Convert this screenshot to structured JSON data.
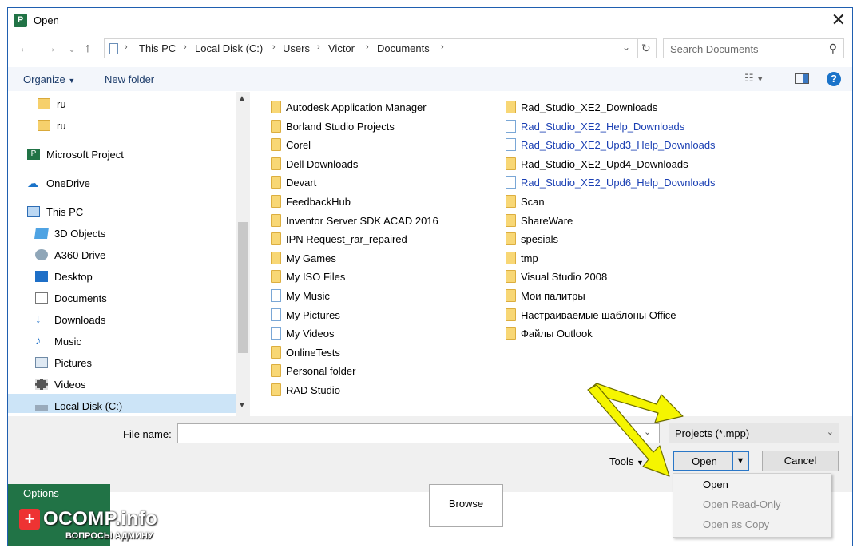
{
  "window": {
    "title": "Open",
    "close": "✕"
  },
  "nav": {
    "back": "←",
    "forward": "→",
    "up": "↑",
    "recent": "⌄"
  },
  "breadcrumb": [
    "This PC",
    "Local Disk (C:)",
    "Users",
    "Victor",
    "Documents"
  ],
  "search": {
    "placeholder": "Search Documents"
  },
  "toolbar": {
    "organize": "Organize",
    "new_folder": "New folder",
    "help": "?"
  },
  "sidebar": {
    "items": [
      {
        "label": "ru",
        "icon": "folder-icon"
      },
      {
        "label": "ru",
        "icon": "folder-icon"
      },
      {
        "label": "Microsoft Project",
        "icon": "microsoft-project-icon"
      },
      {
        "label": "OneDrive",
        "icon": "cloud-icon"
      },
      {
        "label": "This PC",
        "icon": "computer-icon"
      },
      {
        "label": "3D Objects",
        "icon": "cube-icon"
      },
      {
        "label": "A360 Drive",
        "icon": "drive-icon"
      },
      {
        "label": "Desktop",
        "icon": "desktop-icon"
      },
      {
        "label": "Documents",
        "icon": "documents-icon"
      },
      {
        "label": "Downloads",
        "icon": "download-arrow-icon"
      },
      {
        "label": "Music",
        "icon": "music-note-icon"
      },
      {
        "label": "Pictures",
        "icon": "pictures-icon"
      },
      {
        "label": "Videos",
        "icon": "film-icon"
      },
      {
        "label": "Local Disk (C:)",
        "icon": "disk-icon"
      }
    ]
  },
  "files": {
    "col1": [
      {
        "name": "Autodesk Application Manager",
        "kind": "folder"
      },
      {
        "name": "Borland Studio Projects",
        "kind": "folder"
      },
      {
        "name": "Corel",
        "kind": "folder"
      },
      {
        "name": "Dell Downloads",
        "kind": "folder"
      },
      {
        "name": "Devart",
        "kind": "folder"
      },
      {
        "name": "FeedbackHub",
        "kind": "folder"
      },
      {
        "name": "Inventor Server SDK ACAD 2016",
        "kind": "folder"
      },
      {
        "name": "IPN Request_rar_repaired",
        "kind": "folder"
      },
      {
        "name": "My Games",
        "kind": "folder"
      },
      {
        "name": "My ISO Files",
        "kind": "folder"
      },
      {
        "name": "My Music",
        "kind": "shortcut"
      },
      {
        "name": "My Pictures",
        "kind": "shortcut"
      },
      {
        "name": "My Videos",
        "kind": "shortcut"
      },
      {
        "name": "OnlineTests",
        "kind": "folder"
      },
      {
        "name": "Personal folder",
        "kind": "folder"
      },
      {
        "name": "RAD Studio",
        "kind": "folder"
      }
    ],
    "col2": [
      {
        "name": "Rad_Studio_XE2_Downloads",
        "kind": "folder"
      },
      {
        "name": "Rad_Studio_XE2_Help_Downloads",
        "kind": "link"
      },
      {
        "name": "Rad_Studio_XE2_Upd3_Help_Downloads",
        "kind": "link"
      },
      {
        "name": "Rad_Studio_XE2_Upd4_Downloads",
        "kind": "folder"
      },
      {
        "name": "Rad_Studio_XE2_Upd6_Help_Downloads",
        "kind": "link"
      },
      {
        "name": "Scan",
        "kind": "folder"
      },
      {
        "name": "ShareWare",
        "kind": "folder"
      },
      {
        "name": "spesials",
        "kind": "folder"
      },
      {
        "name": "tmp",
        "kind": "folder"
      },
      {
        "name": "Visual Studio 2008",
        "kind": "folder"
      },
      {
        "name": "Мои палитры",
        "kind": "folder"
      },
      {
        "name": "Настраиваемые шаблоны Office",
        "kind": "folder"
      },
      {
        "name": "Файлы Outlook",
        "kind": "folder"
      }
    ]
  },
  "footer": {
    "file_name_label": "File name:",
    "file_name_value": "",
    "file_type": "Projects (*.mpp)",
    "tools": "Tools",
    "open": "Open",
    "cancel": "Cancel"
  },
  "open_menu": [
    "Open",
    "Open Read-Only",
    "Open as Copy"
  ],
  "backstage": {
    "options": "Options",
    "browse": "Browse"
  },
  "watermark": {
    "brand": "OCOMP.info",
    "sub": "ВОПРОСЫ АДМИНУ"
  },
  "colors": {
    "accent": "#217346",
    "selection": "#cce4f7",
    "focus": "#2a77c7",
    "arrow": "#f5f500"
  }
}
